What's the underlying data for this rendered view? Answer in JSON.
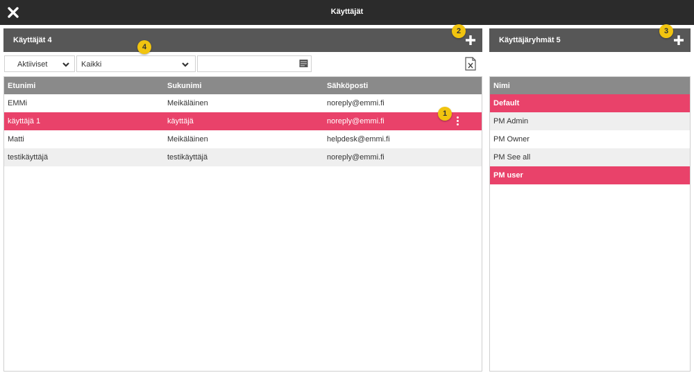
{
  "window": {
    "title": "Käyttäjät",
    "close_icon": "close-icon"
  },
  "users_panel": {
    "title": "Käyttäjät",
    "count": "4",
    "add_icon": "plus-icon"
  },
  "groups_panel": {
    "title": "Käyttäjäryhmät",
    "count": "5",
    "add_icon": "plus-icon"
  },
  "badges": [
    "1",
    "2",
    "3",
    "4"
  ],
  "filters": {
    "status_value": "Aktiiviset",
    "group_value": "Kaikki",
    "search_value": "",
    "search_placeholder": "",
    "export_icon": "excel-export-icon"
  },
  "users_table": {
    "columns": [
      "Etunimi",
      "Sukunimi",
      "Sähköposti"
    ],
    "rows": [
      {
        "first": "EMMi",
        "last": "Meikäläinen",
        "email": "noreply@emmi.fi"
      },
      {
        "first": "käyttäjä 1",
        "last": "käyttäjä",
        "email": "noreply@emmi.fi"
      },
      {
        "first": "Matti",
        "last": "Meikäläinen",
        "email": "helpdesk@emmi.fi"
      },
      {
        "first": "testikäyttäjä",
        "last": "testikäyttäjä",
        "email": "noreply@emmi.fi"
      }
    ],
    "selected_row": 1,
    "row_menu_icon": "kebab-menu-icon"
  },
  "groups_table": {
    "column": "Nimi",
    "rows": [
      "Default",
      "PM Admin",
      "PM Owner",
      "PM See all",
      "PM user"
    ],
    "selected_rows": [
      0,
      4
    ]
  },
  "colors": {
    "titlebar": "#2b2b2b",
    "panel_header": "#575757",
    "table_header": "#8a8a8a",
    "selection": "#e9426a",
    "badge": "#f1c40f"
  }
}
